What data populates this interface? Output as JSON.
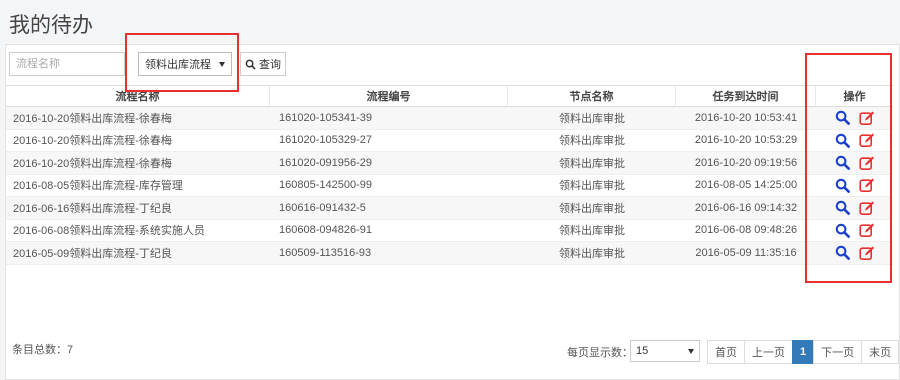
{
  "page": {
    "title": "我的待办"
  },
  "filters": {
    "flow_name_placeholder": "流程名称",
    "flow_type_selected": "领料出库流程",
    "query_label": "查询"
  },
  "table": {
    "headers": [
      "流程名称",
      "流程编号",
      "节点名称",
      "任务到达时间",
      "操作"
    ],
    "rows": [
      [
        "2016-10-20领料出库流程-徐春梅",
        "161020-105341-39",
        "领料出库审批",
        "2016-10-20 10:53:41"
      ],
      [
        "2016-10-20领料出库流程-徐春梅",
        "161020-105329-27",
        "领料出库审批",
        "2016-10-20 10:53:29"
      ],
      [
        "2016-10-20领料出库流程-徐春梅",
        "161020-091956-29",
        "领料出库审批",
        "2016-10-20 09:19:56"
      ],
      [
        "2016-08-05领料出库流程-库存管理",
        "160805-142500-99",
        "领料出库审批",
        "2016-08-05 14:25:00"
      ],
      [
        "2016-06-16领料出库流程-丁纪良",
        "160616-091432-5",
        "领料出库审批",
        "2016-06-16 09:14:32"
      ],
      [
        "2016-06-08领料出库流程-系统实施人员",
        "160608-094826-91",
        "领料出库审批",
        "2016-06-08 09:48:26"
      ],
      [
        "2016-05-09领料出库流程-丁纪良",
        "160509-113516-93",
        "领料出库审批",
        "2016-05-09 11:35:16"
      ]
    ]
  },
  "footer": {
    "record_count": "条目总数：7",
    "per_page_label": "每页显示数：",
    "per_page_value": "15",
    "pager": {
      "first": "首页",
      "prev": "上一页",
      "current": "1",
      "next": "下一页",
      "last": "末页"
    }
  },
  "colors": {
    "view_icon": "#1a3fcf",
    "edit_icon": "#e8312f",
    "highlight_box": "#e8312f",
    "pager_active": "#337ab7"
  },
  "icons": {
    "view": "magnifier-icon",
    "edit": "edit-icon"
  }
}
